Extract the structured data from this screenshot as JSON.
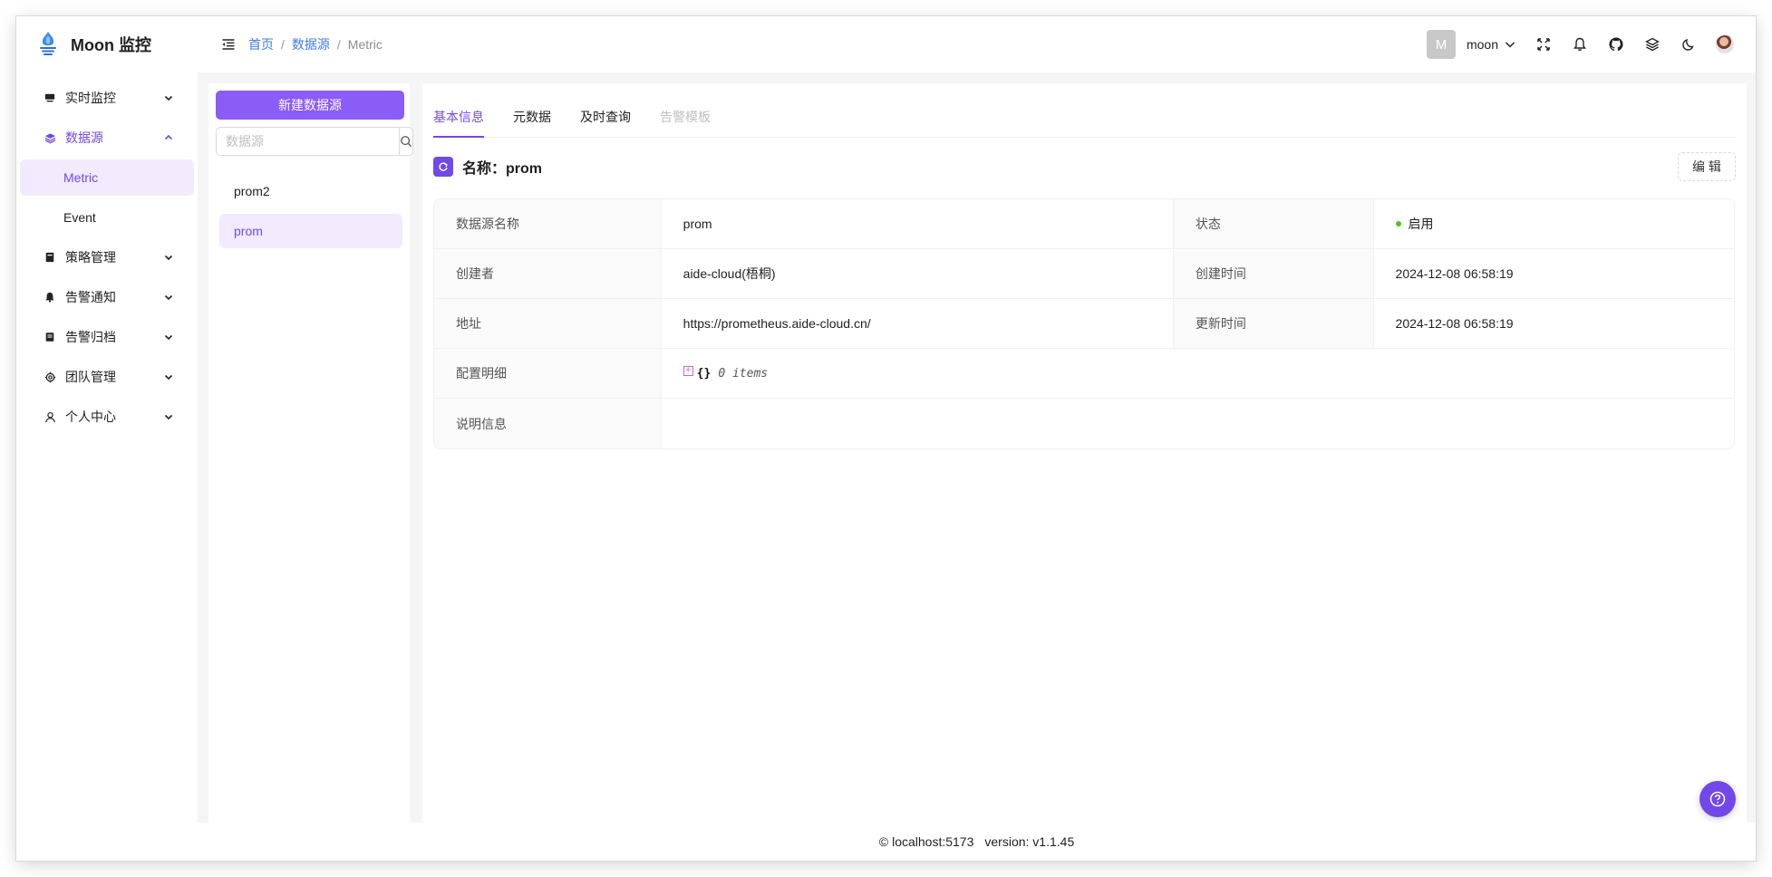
{
  "app": {
    "title": "Moon 监控"
  },
  "sidebar": {
    "items": [
      {
        "label": "实时监控",
        "icon": "monitor-icon"
      },
      {
        "label": "数据源",
        "icon": "layers-icon"
      },
      {
        "label": "策略管理",
        "icon": "book-icon"
      },
      {
        "label": "告警通知",
        "icon": "bell-icon"
      },
      {
        "label": "告警归档",
        "icon": "archive-icon"
      },
      {
        "label": "团队管理",
        "icon": "gear-icon"
      },
      {
        "label": "个人中心",
        "icon": "user-icon"
      }
    ],
    "sub_items": [
      {
        "label": "Metric"
      },
      {
        "label": "Event"
      }
    ]
  },
  "header": {
    "breadcrumb": [
      "首页",
      "数据源",
      "Metric"
    ],
    "avatar_letter": "M",
    "username": "moon"
  },
  "left_panel": {
    "new_button": "新建数据源",
    "search_placeholder": "数据源",
    "items": [
      "prom2",
      "prom"
    ]
  },
  "detail": {
    "tabs": [
      "基本信息",
      "元数据",
      "及时查询",
      "告警模板"
    ],
    "title": "名称：prom",
    "edit_button": "编 辑",
    "rows": {
      "name_label": "数据源名称",
      "name_value": "prom",
      "status_label": "状态",
      "status_value": "启用",
      "creator_label": "创建者",
      "creator_value": "aide-cloud(梧桐)",
      "created_label": "创建时间",
      "created_value": "2024-12-08 06:58:19",
      "address_label": "地址",
      "address_value": "https://prometheus.aide-cloud.cn/",
      "updated_label": "更新时间",
      "updated_value": "2024-12-08 06:58:19",
      "config_label": "配置明细",
      "config_braces": "{}",
      "config_count": "0 items",
      "desc_label": "说明信息",
      "desc_value": ""
    }
  },
  "footer": {
    "copyright_symbol": "©",
    "host": "localhost:5173",
    "version": "version: v1.1.45"
  },
  "colors": {
    "accent": "#7248e8",
    "button": "#8b5cf6",
    "link": "#3f7be8",
    "status_ok": "#52c41a"
  }
}
